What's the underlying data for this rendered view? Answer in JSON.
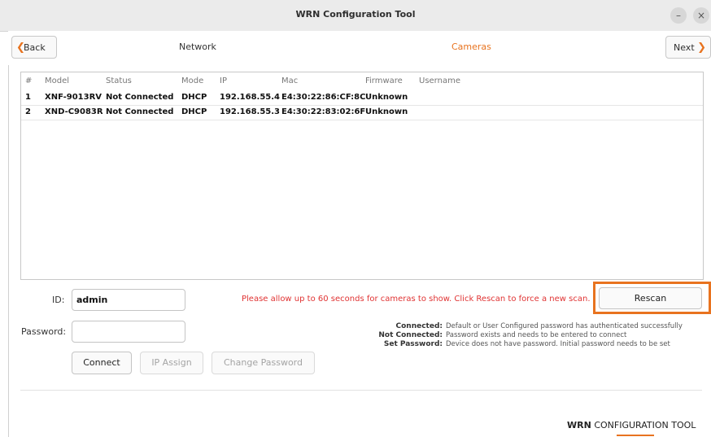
{
  "window": {
    "title": "WRN Configuration Tool"
  },
  "nav": {
    "back_label": "Back",
    "next_label": "Next",
    "tab_network": "Network",
    "tab_cameras": "Cameras",
    "active_tab": "Cameras"
  },
  "table": {
    "columns": [
      "#",
      "Model",
      "Status",
      "Mode",
      "IP",
      "Mac",
      "Firmware",
      "Username"
    ],
    "rows": [
      [
        "1",
        "XNF-9013RV",
        "Not Connected",
        "DHCP",
        "192.168.55.4",
        "E4:30:22:86:CF:8C",
        "Unknown",
        ""
      ],
      [
        "2",
        "XND-C9083R",
        "Not Connected",
        "DHCP",
        "192.168.55.3",
        "E4:30:22:83:02:6F",
        "Unknown",
        ""
      ]
    ]
  },
  "form": {
    "id_label": "ID:",
    "id_value": "admin",
    "password_label": "Password:",
    "password_value": ""
  },
  "buttons": {
    "connect": "Connect",
    "ip_assign": "IP Assign",
    "change_password": "Change Password",
    "rescan": "Rescan"
  },
  "notice": "Please allow up to 60 seconds for cameras to show. Click Rescan to force a new scan.",
  "legend": [
    {
      "key": "Connected:",
      "value": "Default or User Configured password has authenticated successfully"
    },
    {
      "key": "Not Connected:",
      "value": "Password exists and needs to be entered to connect"
    },
    {
      "key": "Set Password:",
      "value": "Device does not have password. Initial password needs to be set"
    }
  ],
  "brand": {
    "strong": "WRN",
    "rest": "CONFIGURATION TOOL"
  },
  "colors": {
    "accent": "#e8731f",
    "notice": "#e03333"
  },
  "icons": {
    "back": "chevron-left-icon",
    "next": "chevron-right-icon",
    "minimize": "minimize-icon",
    "close": "close-icon"
  }
}
